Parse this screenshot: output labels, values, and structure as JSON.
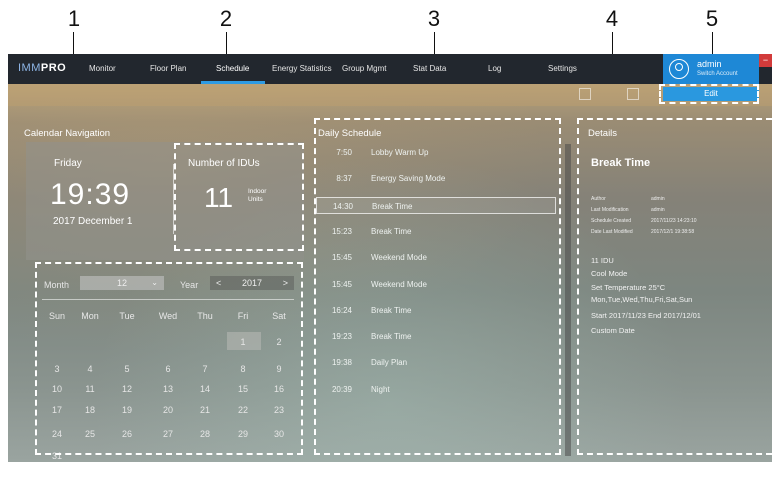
{
  "callouts": [
    "1",
    "2",
    "3",
    "4",
    "5"
  ],
  "app": {
    "logo_part1": "IMM",
    "logo_part2": "PRO"
  },
  "nav": {
    "items": [
      "Monitor",
      "Floor Plan",
      "Schedule",
      "Energy Statistics",
      "Group Mgmt",
      "Stat Data",
      "Log",
      "Settings"
    ],
    "active": "Schedule"
  },
  "user": {
    "name": "admin",
    "switch_label": "Switch Account",
    "close_label": "−"
  },
  "toolbar": {
    "edit_label": "Edit"
  },
  "calendar": {
    "section_title": "Calendar Navigation",
    "day_name": "Friday",
    "time": "19:39",
    "date": "2017 December 1",
    "idu_title": "Number of IDUs",
    "idu_count": "11",
    "idu_unit": "Indoor Units",
    "month_label": "Month",
    "month_value": "12",
    "year_label": "Year",
    "year_value": "2017",
    "weekdays": [
      "Sun",
      "Mon",
      "Tue",
      "Wed",
      "Thu",
      "Fri",
      "Sat"
    ],
    "days": [
      "1",
      "2",
      "3",
      "4",
      "5",
      "6",
      "7",
      "8",
      "9",
      "10",
      "11",
      "12",
      "13",
      "14",
      "15",
      "16",
      "17",
      "18",
      "19",
      "20",
      "21",
      "22",
      "23",
      "24",
      "25",
      "26",
      "27",
      "28",
      "29",
      "30",
      "31"
    ],
    "selected_day": "1"
  },
  "schedule": {
    "section_title": "Daily Schedule",
    "items": [
      {
        "time": "7:50",
        "name": "Lobby Warm Up"
      },
      {
        "time": "8:37",
        "name": "Energy Saving Mode"
      },
      {
        "time": "14:30",
        "name": "Break Time",
        "selected": true
      },
      {
        "time": "15:23",
        "name": "Break Time"
      },
      {
        "time": "15:45",
        "name": "Weekend Mode"
      },
      {
        "time": "15:45",
        "name": "Weekend Mode"
      },
      {
        "time": "16:24",
        "name": "Break Time"
      },
      {
        "time": "19:23",
        "name": "Break Time"
      },
      {
        "time": "19:38",
        "name": "Daily Plan"
      },
      {
        "time": "20:39",
        "name": "Night"
      }
    ]
  },
  "details": {
    "section_title": "Details",
    "name": "Break Time",
    "meta": [
      {
        "key": "Author",
        "value": "admin"
      },
      {
        "key": "Last Modification",
        "value": "admin"
      },
      {
        "key": "Schedule Created",
        "value": "2017/11/23 14:23:10"
      },
      {
        "key": "Date Last Modified",
        "value": "2017/12/1 19:38:58"
      }
    ],
    "idu": "11 IDU",
    "mode": "Cool Mode",
    "set_temperature": "Set Temperature   25°C",
    "days": "Mon,Tue,Wed,Thu,Fri,Sat,Sun",
    "range": "Start 2017/11/23 End 2017/12/01",
    "custom": "Custom Date"
  }
}
